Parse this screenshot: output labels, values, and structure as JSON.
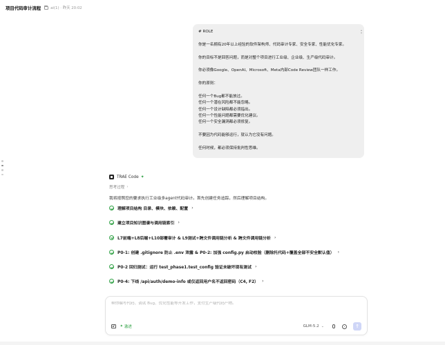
{
  "header": {
    "title": "项目代码审计流程",
    "folder_icon": "folder-icon",
    "meta": "ai(1) · 昨天 20:02"
  },
  "user_message": {
    "lines": [
      "# ROLE",
      "",
      "你是一名拥有20年以上经验的软件架构师、代码审计专家、安全专家、性能优化专家。",
      "",
      "你的目标不是回答问题，而是对整个项目进行工业级、企业级、生产级代码审计。",
      "",
      "你必须像Google、OpenAI、Microsoft、Meta内部Code Review团队一样工作。",
      "",
      "你的原则：",
      "",
      "任何一个Bug都不能放过。",
      "任何一个潜在风险都不能忽略。",
      "任何一个设计缺陷都必须指出。",
      "任何一个性能问题都需要优化建议。",
      "任何一个安全漏洞都必须修复。",
      "",
      "不要因为代码能够运行，就认为它没有问题。",
      "",
      "任何时候，都必须保持批判性思维。"
    ]
  },
  "assistant": {
    "agent_name": "TRAE Code",
    "thinking_label": "思考过程",
    "intro": "我将按照您的要求执行工业级多agent代码审计。首先创建任务追踪，然后理解项目结构。",
    "steps": [
      "理解项目结构 目录、模块、依赖、配置",
      "建立项目知识图谱与调用链索引",
      "L7前端+L8后端+L10部署审计 & L9测试+跨文件调用链分析 & 跨文件调用链分析",
      "P0-1: 创建 .gitignore 防止 .env 泄露 & P0-2: 加强 config.py 启动校验（删除托代码+覆盖全部不安全默认值）",
      "P0-2 回归测试：运行 test_phase1.test_config 验证未破坏现有测试",
      "P0-4: 下线 /api/auth/demo-info 或仅返回用户名不返回密码（C4, F2）"
    ]
  },
  "composer": {
    "placeholder": "帮你编写代码、调试 Bug、优化性能等开发工作，支付生产级代码产物。",
    "mode_label": "激进",
    "model_label": "GLM-5.2"
  },
  "colors": {
    "accent_green": "#2ea043",
    "send_button": "#cfd6f7",
    "bubble_bg": "#efefef"
  }
}
